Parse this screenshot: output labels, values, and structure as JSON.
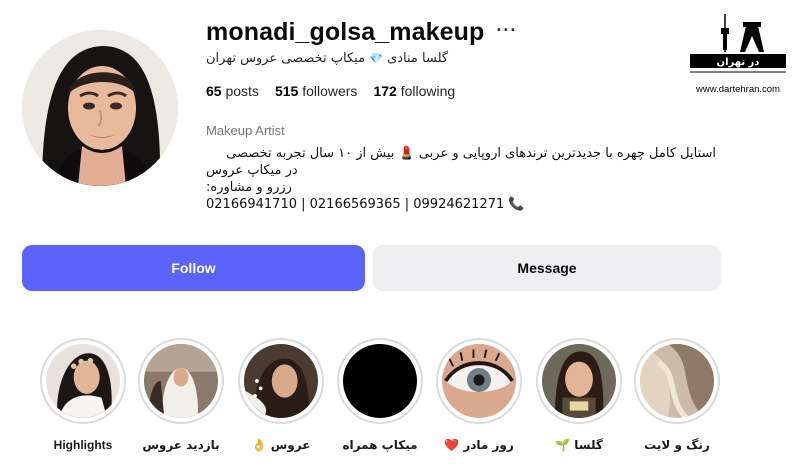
{
  "profile": {
    "username": "monadi_golsa_makeup",
    "more_label": "···",
    "full_name": "گلسا منادی",
    "full_name_badge": "💎",
    "full_name_rest": "میکاپ تخصصی عروس تهران",
    "stats": {
      "posts_count": "65",
      "posts_label": "posts",
      "followers_count": "515",
      "followers_label": "followers",
      "following_count": "172",
      "following_label": "following"
    },
    "category": "Makeup Artist",
    "bio": {
      "line1": "استایل کامل چهره با جدیدترین ترندهای اروپایی و عربی",
      "line1_emoji": "💄",
      "line1_tail": "بیش از ۱۰ سال تجربه تخصصی",
      "line2": "در میکاپ عروس",
      "line3": "رزرو و مشاوره:",
      "phones": "02166941710 | 02166569365 | 09924621271",
      "phone_emoji": "📞"
    }
  },
  "actions": {
    "follow_label": "Follow",
    "message_label": "Message"
  },
  "watermark": {
    "logo_text": "در تهران",
    "site": "www.dartehran.com"
  },
  "highlights": [
    {
      "label": "رنگ و لایت",
      "icon": "hair-color-photo"
    },
    {
      "label": "گلسا 🌱",
      "icon": "selfie-photo"
    },
    {
      "label": "روز مادر ❤️",
      "icon": "eye-closeup-photo"
    },
    {
      "label": "میکاپ همراه",
      "icon": "black-cover"
    },
    {
      "label": "عروس 👌",
      "icon": "bride-photo"
    },
    {
      "label": "بازدید عروس",
      "icon": "bride-visit-photo"
    },
    {
      "label": "Highlights",
      "icon": "bride-portrait-photo"
    }
  ],
  "colors": {
    "follow_button": "#5b63fb",
    "message_button": "#efeff1",
    "ring": "#dbdbdb"
  }
}
